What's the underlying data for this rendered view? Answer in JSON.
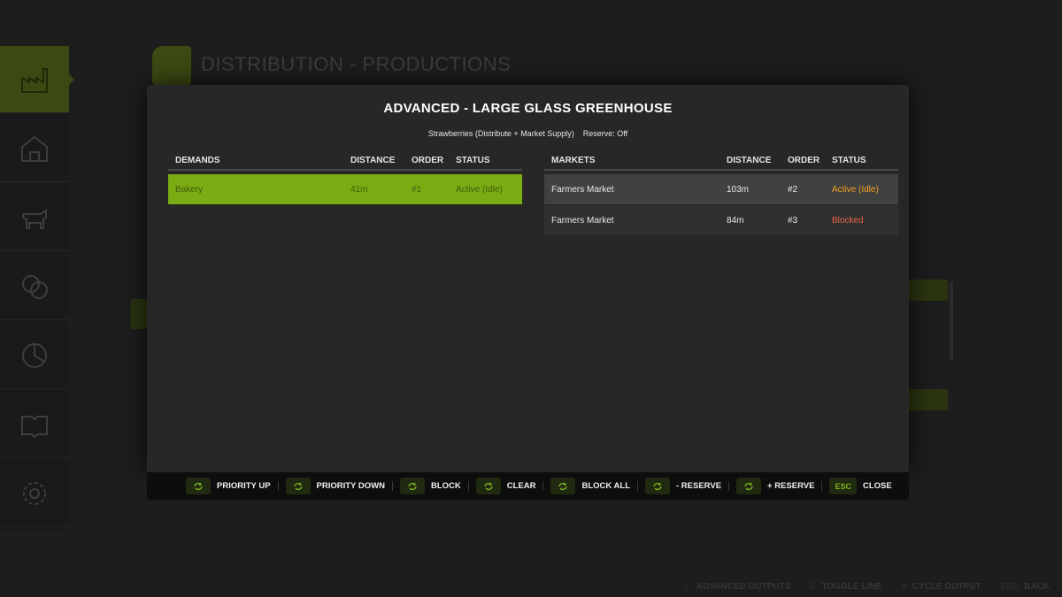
{
  "background": {
    "title": "DISTRIBUTION - PRODUCTIONS",
    "footer": [
      {
        "key": "✓",
        "label": "ADVANCED OUTPUTS"
      },
      {
        "key": "C",
        "label": "TOGGLE LINE"
      },
      {
        "key": "X",
        "label": "CYCLE OUTPUT"
      },
      {
        "key": "ESC",
        "label": "BACK"
      }
    ]
  },
  "modal": {
    "title": "ADVANCED - LARGE GLASS GREENHOUSE",
    "product": "Strawberries  (Distribute + Market Supply)",
    "reserve": "Reserve: Off",
    "demands": {
      "headers": [
        "DEMANDS",
        "DISTANCE",
        "ORDER",
        "STATUS"
      ],
      "rows": [
        {
          "name": "Bakery",
          "distance": "41m",
          "order": "#1",
          "status": "Active (Idle)"
        }
      ]
    },
    "markets": {
      "headers": [
        "MARKETS",
        "DISTANCE",
        "ORDER",
        "STATUS"
      ],
      "rows": [
        {
          "name": "Farmers Market",
          "distance": "103m",
          "order": "#2",
          "status": "Active (Idle)"
        },
        {
          "name": "Farmers Market",
          "distance": "84m",
          "order": "#3",
          "status": "Blocked"
        }
      ]
    }
  },
  "actions": [
    {
      "key_icon": "mouse-click-icon",
      "label": "PRIORITY UP"
    },
    {
      "key_icon": "mouse-click-icon",
      "label": "PRIORITY DOWN"
    },
    {
      "key_icon": "mouse-click-icon",
      "label": "BLOCK"
    },
    {
      "key_icon": "mouse-click-icon",
      "label": "CLEAR"
    },
    {
      "key_icon": "mouse-click-icon",
      "label": "BLOCK ALL"
    },
    {
      "key_icon": "mouse-click-icon",
      "label": "- RESERVE"
    },
    {
      "key_icon": "mouse-click-icon",
      "label": "+ RESERVE"
    },
    {
      "key_text": "ESC",
      "label": "CLOSE"
    }
  ],
  "colors": {
    "accent": "#7aac14",
    "active_status": "#f0a020",
    "blocked_status": "#e86448"
  }
}
